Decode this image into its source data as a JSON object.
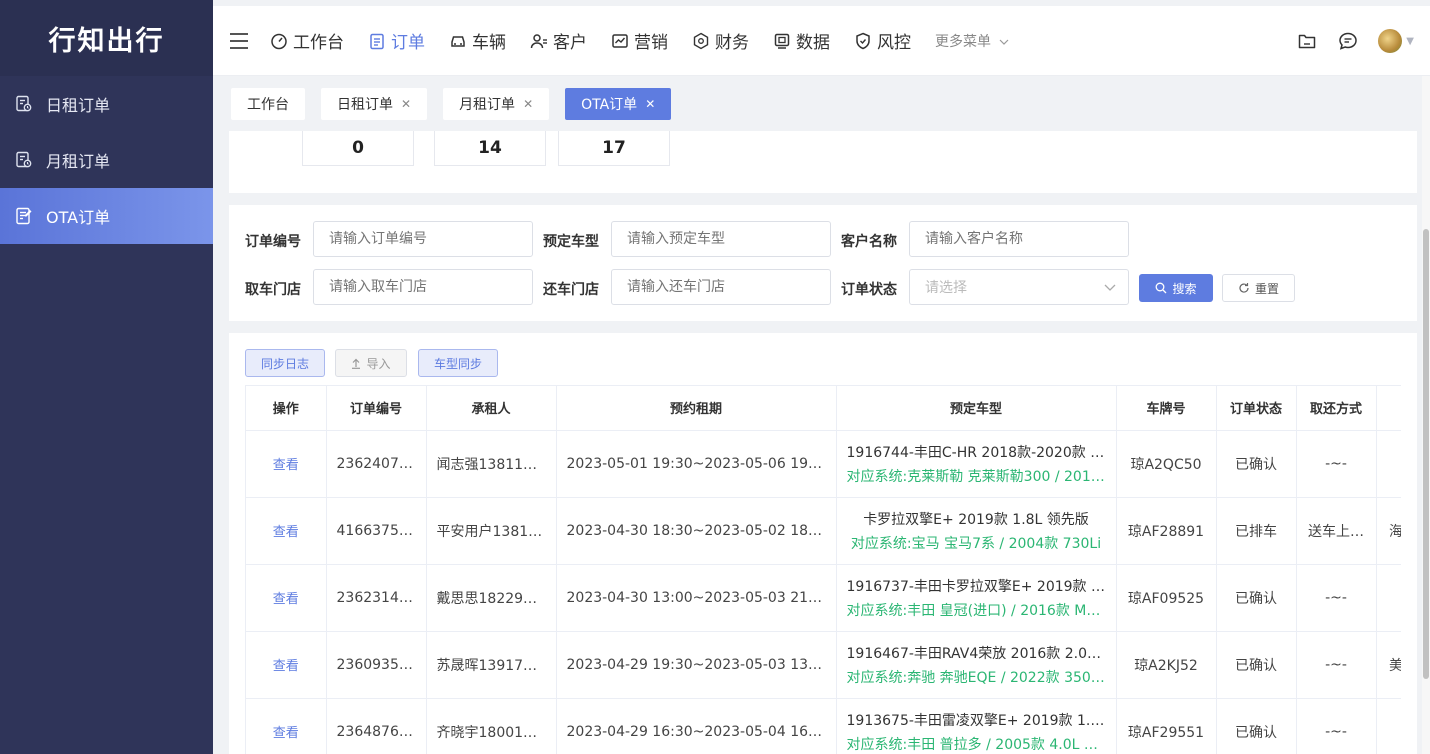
{
  "app": {
    "brand": "行知出行"
  },
  "sidebar": {
    "items": [
      {
        "label": "日租订单",
        "icon": "order-doc-icon",
        "active": false
      },
      {
        "label": "月租订单",
        "icon": "order-doc-icon",
        "active": false
      },
      {
        "label": "OTA订单",
        "icon": "order-edit-icon",
        "active": true
      }
    ]
  },
  "topnav": {
    "items": [
      {
        "label": "工作台",
        "icon": "dashboard-icon"
      },
      {
        "label": "订单",
        "icon": "clipboard-icon",
        "active": true
      },
      {
        "label": "车辆",
        "icon": "car-icon"
      },
      {
        "label": "客户",
        "icon": "users-icon"
      },
      {
        "label": "营销",
        "icon": "chart-icon"
      },
      {
        "label": "财务",
        "icon": "finance-icon"
      },
      {
        "label": "数据",
        "icon": "data-icon"
      },
      {
        "label": "风控",
        "icon": "shield-icon"
      }
    ],
    "more": "更多菜单"
  },
  "tabs": [
    {
      "label": "工作台",
      "closable": false
    },
    {
      "label": "日租订单",
      "closable": true
    },
    {
      "label": "月租订单",
      "closable": true
    },
    {
      "label": "OTA订单",
      "closable": true,
      "active": true
    }
  ],
  "stats": {
    "values": [
      "0",
      "14",
      "17"
    ]
  },
  "filters": {
    "order_no": {
      "label": "订单编号",
      "placeholder": "请输入订单编号"
    },
    "car_model": {
      "label": "预定车型",
      "placeholder": "请输入预定车型"
    },
    "customer": {
      "label": "客户名称",
      "placeholder": "请输入客户名称"
    },
    "pickup_store": {
      "label": "取车门店",
      "placeholder": "请输入取车门店"
    },
    "return_store": {
      "label": "还车门店",
      "placeholder": "请输入还车门店"
    },
    "status": {
      "label": "订单状态",
      "placeholder": "请选择"
    },
    "search_label": "搜索",
    "reset_label": "重置"
  },
  "toolbar": {
    "sync_log": "同步日志",
    "import": "导入",
    "model_sync": "车型同步"
  },
  "table": {
    "columns": [
      "操作",
      "订单编号",
      "承租人",
      "预约租期",
      "预定车型",
      "车牌号",
      "订单状态",
      "取还方式",
      ""
    ],
    "rows": [
      {
        "action": "查看",
        "order_no": "23624075…",
        "renter": "闻志强138111…",
        "period": "2023-05-01 19:30~2023-05-06 19:30",
        "car": "1916744-丰田C-HR 2018款-2020款 2.…",
        "car_sys": "对应系统:克莱斯勒 克莱斯勒300 / 2016…",
        "plate": "琼A2QC50",
        "status": "已确认",
        "method": "-~-",
        "extra": ""
      },
      {
        "action": "查看",
        "order_no": "41663750…",
        "renter": "平安用户13811…",
        "period": "2023-04-30 18:30~2023-05-02 18:00",
        "car": "卡罗拉双擎E+ 2019款 1.8L 领先版",
        "car_sys": "对应系统:宝马 宝马7系 / 2004款 730Li",
        "plate": "琼AF28891",
        "status": "已排车",
        "method": "送车上…",
        "extra": "海"
      },
      {
        "action": "查看",
        "order_no": "23623140…",
        "renter": "戴思思182298…",
        "period": "2023-04-30 13:00~2023-05-03 21:00",
        "car": "1916737-丰田卡罗拉双擎E+ 2019款 1.…",
        "car_sys": "对应系统:丰田 皇冠(进口) / 2016款 MA…",
        "plate": "琼AF09525",
        "status": "已确认",
        "method": "-~-",
        "extra": ""
      },
      {
        "action": "查看",
        "order_no": "23609352…",
        "renter": "苏晟晖139177…",
        "period": "2023-04-29 19:30~2023-05-03 13:30",
        "car": "1916467-丰田RAV4荣放 2016款 2.0L 5…",
        "car_sys": "对应系统:奔驰 奔驰EQE / 2022款 350 …",
        "plate": "琼A2KJ52",
        "status": "已确认",
        "method": "-~-",
        "extra": "美"
      },
      {
        "action": "查看",
        "order_no": "23648768…",
        "renter": "齐晓宇180011…",
        "period": "2023-04-29 16:30~2023-05-04 16:30",
        "car": "1913675-丰田雷凌双擎E+ 2019款 1.8L…",
        "car_sys": "对应系统:丰田 普拉多 / 2005款 4.0L 自…",
        "plate": "琼AF29551",
        "status": "已确认",
        "method": "-~-",
        "extra": ""
      }
    ]
  }
}
